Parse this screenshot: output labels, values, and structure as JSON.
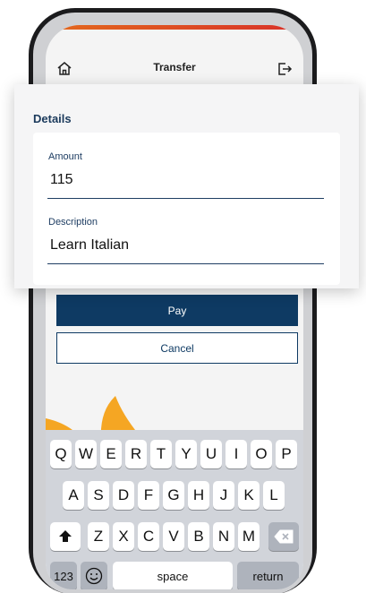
{
  "header": {
    "title": "Transfer",
    "home_icon": "home-icon",
    "logout_icon": "logout-icon"
  },
  "details": {
    "heading": "Details",
    "amount_label": "Amount",
    "amount_value": "115",
    "description_label": "Description",
    "description_value": "Learn Italian"
  },
  "actions": {
    "pay_label": "Pay",
    "cancel_label": "Cancel"
  },
  "keyboard": {
    "row1": [
      "Q",
      "W",
      "E",
      "R",
      "T",
      "Y",
      "U",
      "I",
      "O",
      "P"
    ],
    "row2": [
      "A",
      "S",
      "D",
      "F",
      "G",
      "H",
      "J",
      "K",
      "L"
    ],
    "row3": [
      "Z",
      "X",
      "C",
      "V",
      "B",
      "N",
      "M"
    ],
    "numbers_label": "123",
    "space_label": "space",
    "return_label": "return"
  },
  "colors": {
    "primary": "#0e3a63",
    "accent": "#f5a623",
    "top_bar": "#e36a1d"
  }
}
